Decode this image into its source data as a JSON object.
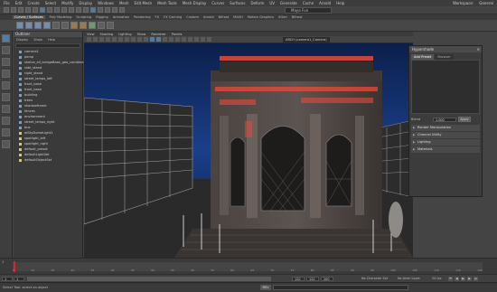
{
  "menubar": {
    "items": [
      "File",
      "Edit",
      "Create",
      "Select",
      "Modify",
      "Display",
      "Windows",
      "Mesh",
      "Edit Mesh",
      "Mesh Tools",
      "Mesh Display",
      "Curves",
      "Surfaces",
      "Deform",
      "UV",
      "Generate",
      "Cache",
      "Arnold",
      "Help"
    ],
    "workspace_label": "Workspace:",
    "workspace_value": "General"
  },
  "toolbar": {
    "search_value": "Maya Fun"
  },
  "shelf_tabs": [
    "Curves / Surfaces",
    "Poly Modeling",
    "Sculpting",
    "Rigging",
    "Animation",
    "Rendering",
    "FX",
    "FX Caching",
    "Custom",
    "Arnold",
    "Bifrost",
    "MASH",
    "Motion Graphics",
    "XGen",
    "Bifrost"
  ],
  "shelf_active_index": 0,
  "outliner": {
    "title": "Outliner",
    "menus": [
      "Display",
      "Show",
      "Help"
    ],
    "items": [
      {
        "label": "camera1",
        "type": "cam"
      },
      {
        "label": "persp",
        "type": "cam"
      },
      {
        "label": "shelve_all_bridgeBase_geo_combine",
        "type": "geo"
      },
      {
        "label": "side_stand",
        "type": "geo"
      },
      {
        "label": "right_stand",
        "type": "geo"
      },
      {
        "label": "street_lamps_left",
        "type": "geo"
      },
      {
        "label": "front_base",
        "type": "geo"
      },
      {
        "label": "front_base",
        "type": "geo"
      },
      {
        "label": "building",
        "type": "geo"
      },
      {
        "label": "trees",
        "type": "geo"
      },
      {
        "label": "shadowframe",
        "type": "geo"
      },
      {
        "label": "fences",
        "type": "geo"
      },
      {
        "label": "environment",
        "type": "geo"
      },
      {
        "label": "street_lamps_right",
        "type": "geo"
      },
      {
        "label": "bus",
        "type": "geo"
      },
      {
        "label": "aiSkyDomeLight1",
        "type": "light"
      },
      {
        "label": "spotlight_left",
        "type": "light"
      },
      {
        "label": "spotlight_right",
        "type": "light"
      },
      {
        "label": "default_preset",
        "type": "light"
      },
      {
        "label": "defaultLightSet",
        "type": "light"
      },
      {
        "label": "defaultObjectSet",
        "type": "light"
      }
    ]
  },
  "viewport": {
    "menus": [
      "View",
      "Shading",
      "Lighting",
      "Show",
      "Renderer",
      "Panels"
    ],
    "camera_label": "ARCH (camera1_Camera)"
  },
  "hypershade": {
    "title": "Hypershade",
    "tabs": [
      "Add Preset",
      "Browser"
    ],
    "active_tab": 0,
    "blend_label": "Blend",
    "blend_value": "1.000",
    "blend_button": "Apply",
    "sections": [
      "Render Manipulation",
      "Channel Utility",
      "Lighting",
      "Materials"
    ]
  },
  "timeslider": {
    "start_label": "1",
    "ticks": [
      "5",
      "10",
      "15",
      "20",
      "25",
      "30",
      "35",
      "40",
      "45",
      "50",
      "55",
      "60",
      "65",
      "70",
      "75",
      "80",
      "85",
      "90",
      "95",
      "100",
      "105",
      "110",
      "115",
      "120"
    ]
  },
  "range": {
    "start": "1",
    "start2": "1",
    "end": "120",
    "end2": "120",
    "end3": "200",
    "no_character_set": "No Character Set",
    "no_anim_layer": "No Anim Layer",
    "fps": "24 fps"
  },
  "statusbar": {
    "help_text": "Select Tool: select an object",
    "mel_label": "MEL"
  },
  "colors": {
    "accent": "#4d7cb0",
    "glow": "#e84a3a",
    "sky": "#1a3f8a"
  }
}
